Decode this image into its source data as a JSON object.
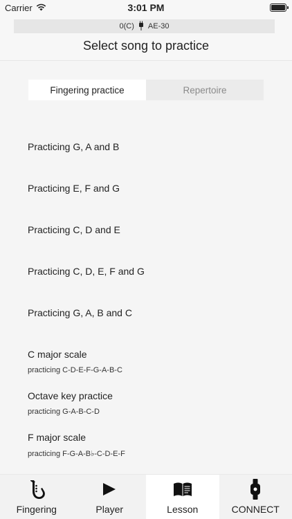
{
  "status_bar": {
    "carrier": "Carrier",
    "time": "3:01 PM"
  },
  "device": {
    "left": "0(C)",
    "right": "AE-30"
  },
  "page_title": "Select song to practice",
  "segments": [
    {
      "label": "Fingering practice",
      "active": true
    },
    {
      "label": "Repertoire",
      "active": false
    }
  ],
  "songs": [
    {
      "title": "Practicing G, A and B"
    },
    {
      "title": "Practicing E, F and G"
    },
    {
      "title": "Practicing C, D and E"
    },
    {
      "title": "Practicing C, D, E, F and G"
    },
    {
      "title": "Practicing G, A, B and C"
    },
    {
      "title": "C major scale",
      "subtitle": "practicing C-D-E-F-G-A-B-C"
    },
    {
      "title": "Octave key practice",
      "subtitle": "practicing G-A-B-C-D"
    },
    {
      "title": "F major scale",
      "subtitle": "practicing F-G-A-B♭-C-D-E-F"
    }
  ],
  "tabs": [
    {
      "label": "Fingering",
      "icon": "saxophone-icon"
    },
    {
      "label": "Player",
      "icon": "play-icon"
    },
    {
      "label": "Lesson",
      "icon": "book-icon",
      "active": true
    },
    {
      "label": "CONNECT",
      "icon": "watch-icon"
    }
  ]
}
